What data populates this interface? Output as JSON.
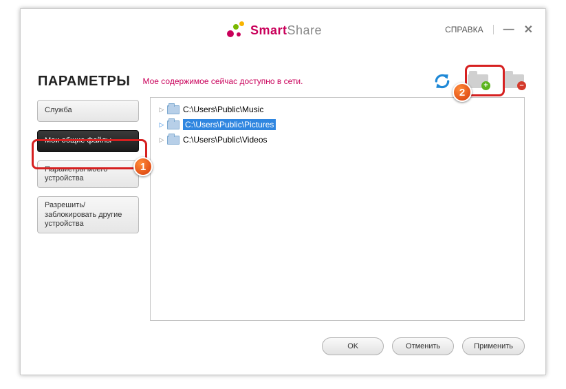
{
  "app": {
    "smart": "Smart",
    "share": "Share",
    "help": "СПРАВКА"
  },
  "page": {
    "title": "ПАРАМЕТРЫ",
    "status": "Мое содержимое сейчас доступно в сети."
  },
  "sidebar": {
    "items": [
      {
        "label": "Служба",
        "active": false
      },
      {
        "label": "Мои общие файлы",
        "active": true
      },
      {
        "label": "Параметры моего устройства",
        "active": false
      },
      {
        "label": "Разрешить/\nзаблокировать другие устройства",
        "active": false
      }
    ]
  },
  "folders": [
    {
      "path": "C:\\Users\\Public\\Music",
      "selected": false
    },
    {
      "path": "C:\\Users\\Public\\Pictures",
      "selected": true
    },
    {
      "path": "C:\\Users\\Public\\Videos",
      "selected": false
    }
  ],
  "buttons": {
    "ok": "OK",
    "cancel": "Отменить",
    "apply": "Применить"
  },
  "callouts": {
    "one": "1",
    "two": "2"
  }
}
